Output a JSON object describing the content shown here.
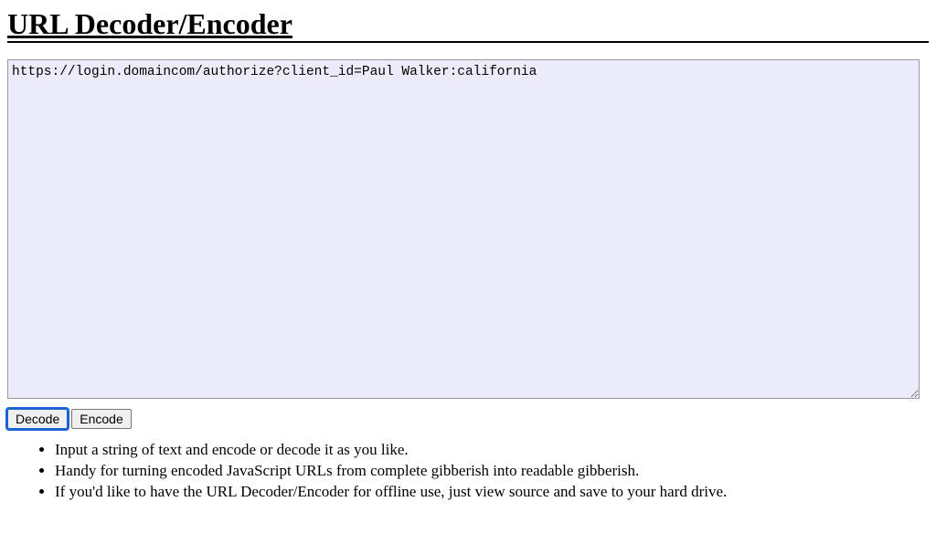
{
  "page": {
    "title": "URL Decoder/Encoder"
  },
  "form": {
    "textarea_value": "https://login.domaincom/authorize?client_id=Paul Walker:california",
    "decode_label": "Decode",
    "encode_label": "Encode"
  },
  "instructions": {
    "items": [
      "Input a string of text and encode or decode it as you like.",
      "Handy for turning encoded JavaScript URLs from complete gibberish into readable gibberish.",
      "If you'd like to have the URL Decoder/Encoder for offline use, just view source and save to your hard drive."
    ]
  }
}
